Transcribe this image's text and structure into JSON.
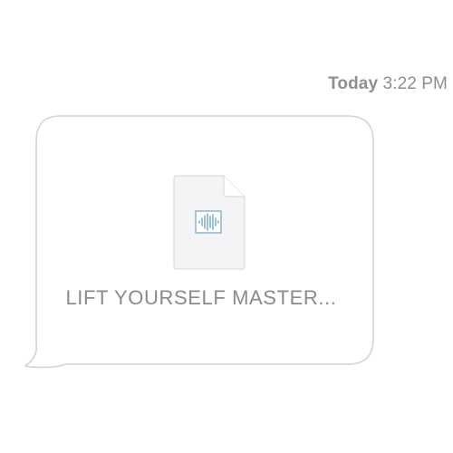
{
  "message": {
    "timestamp_day": "Today",
    "timestamp_time": "3:22 PM",
    "attachment": {
      "file_name": "LIFT YOURSELF MASTER...",
      "icon": "audio-file-icon"
    }
  },
  "colors": {
    "bubble_border": "#d6d6d9",
    "text_gray": "#8e8e93",
    "waveform": "#7fb2c9",
    "icon_bg": "#f4f4f6"
  }
}
